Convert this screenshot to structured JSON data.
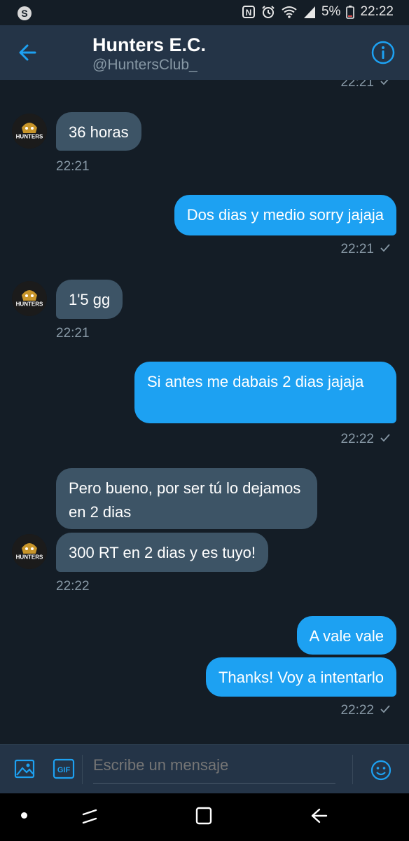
{
  "status_bar": {
    "battery": "5%",
    "time": "22:22",
    "icons": [
      "samsung-s-icon",
      "nfc-icon",
      "alarm-icon",
      "wifi-icon",
      "signal-icon",
      "battery-icon"
    ]
  },
  "header": {
    "title": "Hunters E.C.",
    "handle": "@HuntersClub_",
    "back_icon": "arrow-left-icon",
    "info_icon": "info-icon"
  },
  "messages": [
    {
      "type": "timestamp",
      "text": "22:21",
      "side": "right"
    },
    {
      "type": "in",
      "text": "36 horas"
    },
    {
      "type": "timestamp",
      "text": "22:21",
      "side": "left"
    },
    {
      "type": "out",
      "text": "Dos dias y medio sorry jajaja"
    },
    {
      "type": "timestamp",
      "text": "22:21",
      "side": "right"
    },
    {
      "type": "in",
      "text": "1'5 gg"
    },
    {
      "type": "timestamp",
      "text": "22:21",
      "side": "left"
    },
    {
      "type": "out",
      "text": "Si antes me dabais 2 dias jajaja"
    },
    {
      "type": "timestamp",
      "text": "22:22",
      "side": "right"
    },
    {
      "type": "in",
      "text": "Pero bueno, por ser tú lo dejamos en 2 dias"
    },
    {
      "type": "in",
      "text": "300 RT en 2 dias y es tuyo!"
    },
    {
      "type": "timestamp",
      "text": "22:22",
      "side": "left"
    },
    {
      "type": "out",
      "text": "A vale vale"
    },
    {
      "type": "out",
      "text": "Thanks! Voy a intentarlo"
    },
    {
      "type": "timestamp",
      "text": "22:22",
      "side": "right"
    }
  ],
  "compose": {
    "placeholder": "Escribe un mensaje",
    "gif_label": "GIF",
    "image_icon": "image-icon",
    "emoji_icon": "emoji-icon"
  },
  "avatar_label": "HUNTERS",
  "colors": {
    "background": "#141d26",
    "header": "#243447",
    "incoming_bubble": "#3d5466",
    "outgoing_bubble": "#1da1f2",
    "muted_text": "#8899a6",
    "accent": "#1da1f2"
  }
}
